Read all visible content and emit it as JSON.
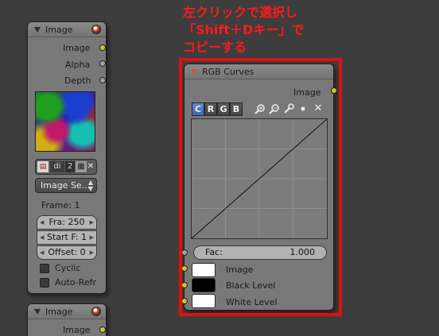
{
  "annotation": {
    "text": "左クリックで選択し\n「Shift＋Dキー」で\nコピーする",
    "color": "#ff1a1a"
  },
  "image_node": {
    "title": "Image",
    "outputs": [
      "Image",
      "Alpha",
      "Depth"
    ],
    "imagebar": {
      "name": "di",
      "users": "2"
    },
    "source_dropdown": "Image Se...",
    "frame_label": "Frame: 1",
    "fields": {
      "frames": "Fra:  250",
      "start": "Start F: 1",
      "offset": "Offset:  0"
    },
    "cyclic_label": "Cyclic",
    "auto_refresh_label": "Auto-Refr"
  },
  "image_node_2": {
    "title": "Image",
    "output": "Image"
  },
  "curves_node": {
    "title": "RGB Curves",
    "output": "Image",
    "channel_tabs": [
      "C",
      "R",
      "G",
      "B"
    ],
    "active_channel": "C",
    "fac_label": "Fac:",
    "fac_value": "1.000",
    "inputs": [
      "Image",
      "Black Level",
      "White Level"
    ],
    "swatch_colors": [
      "#ffffff",
      "#000000",
      "#ffffff"
    ],
    "curve": [
      [
        0,
        0
      ],
      [
        1,
        1
      ]
    ]
  },
  "colors": {
    "node_body": "#787878",
    "socket_color": "#c7c729",
    "socket_value": "#a1a1a1",
    "active_tab": "#4c78c8",
    "highlight_frame": "#e01010"
  }
}
